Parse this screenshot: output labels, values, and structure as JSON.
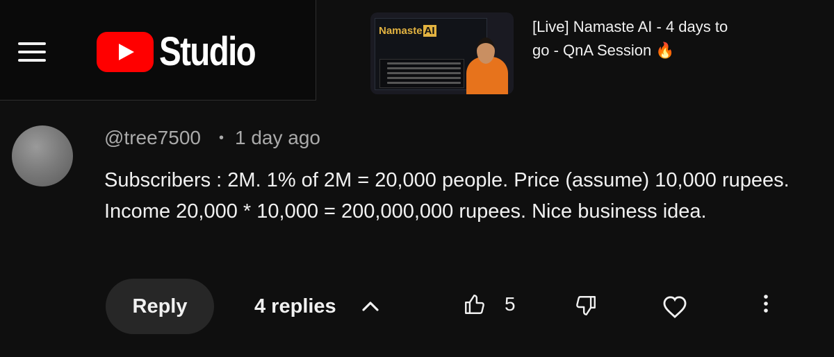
{
  "header": {
    "logo_text": "Studio"
  },
  "video": {
    "title": "[Live] Namaste AI - 4 days to go - QnA Session 🔥",
    "thumbnail_title_word": "Namaste",
    "thumbnail_title_badge": "AI"
  },
  "comment": {
    "author": "@tree7500",
    "separator": "•",
    "time": "1 day ago",
    "text": "Subscribers : 2M. 1% of 2M = 20,000 people. Price (assume) 10,000 rupees. Income 20,000 * 10,000 = 200,000,000 rupees. Nice business idea.",
    "reply_label": "Reply",
    "replies_label": "4 replies",
    "like_count": "5"
  },
  "icons": {
    "menu": "hamburger-menu-icon",
    "logo": "youtube-play-icon",
    "replies_toggle": "chevron-up-icon",
    "like": "thumbs-up-icon",
    "dislike": "thumbs-down-icon",
    "heart": "heart-icon",
    "more": "more-vertical-icon"
  },
  "colors": {
    "background": "#0f0f0f",
    "brand_red": "#ff0000",
    "text_primary": "#f1f1f1",
    "text_secondary": "#aaaaaa",
    "button_bg": "#272727"
  }
}
